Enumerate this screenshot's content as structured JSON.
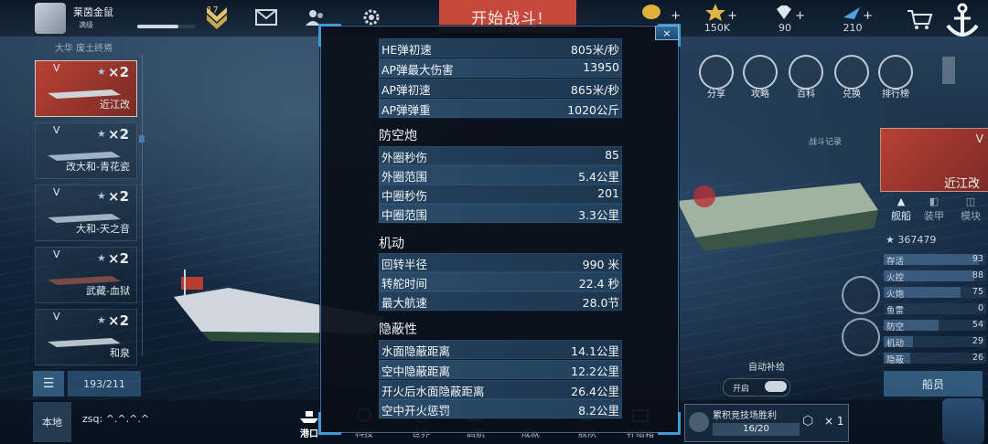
{
  "top": {
    "player_name": "莱茵金鼠",
    "player_sub": "满级",
    "level": "17",
    "start_battle": "开始战斗!",
    "resources": [
      {
        "name": "gold",
        "value": ""
      },
      {
        "name": "medal",
        "value": "150K"
      },
      {
        "name": "diamond",
        "value": "90"
      },
      {
        "name": "fighter",
        "value": "210"
      }
    ],
    "plus": "+"
  },
  "left": {
    "title": "大华 废土终焉",
    "ships": [
      {
        "tier": "V",
        "count": "×2",
        "name": "近江改"
      },
      {
        "tier": "V",
        "count": "×2",
        "name": "改大和-青花瓷"
      },
      {
        "tier": "V",
        "count": "×2",
        "name": "大和-天之音"
      },
      {
        "tier": "V",
        "count": "×2",
        "name": "武藏-血狱"
      },
      {
        "tier": "V",
        "count": "×2",
        "name": "和泉"
      }
    ],
    "count": "193/211"
  },
  "modal": {
    "close": "×",
    "top_rows": [
      {
        "k": "HE弹初速",
        "v": "805米/秒"
      },
      {
        "k": "AP弹最大伤害",
        "v": "13950"
      },
      {
        "k": "AP弹初速",
        "v": "865米/秒"
      },
      {
        "k": "AP弹弹重",
        "v": "1020公斤"
      }
    ],
    "sections": [
      {
        "title": "防空炮",
        "rows": [
          {
            "k": "外圈秒伤",
            "v": "85"
          },
          {
            "k": "外圈范围",
            "v": "5.4公里"
          },
          {
            "k": "中圈秒伤",
            "v": "201"
          },
          {
            "k": "中圈范围",
            "v": "3.3公里"
          }
        ]
      },
      {
        "title": "机动",
        "rows": [
          {
            "k": "回转半径",
            "v": "990 米"
          },
          {
            "k": "转舵时间",
            "v": "22.4 秒"
          },
          {
            "k": "最大航速",
            "v": "28.0节"
          }
        ]
      },
      {
        "title": "隐蔽性",
        "rows": [
          {
            "k": "水面隐蔽距离",
            "v": "14.1公里"
          },
          {
            "k": "空中隐蔽距离",
            "v": "12.2公里"
          },
          {
            "k": "开火后水面隐蔽距离",
            "v": "26.4公里"
          },
          {
            "k": "空中开火惩罚",
            "v": "8.2公里"
          }
        ]
      }
    ]
  },
  "right": {
    "menu": [
      {
        "label": "分享"
      },
      {
        "label": "攻略"
      },
      {
        "label": "百科"
      },
      {
        "label": "兑换"
      },
      {
        "label": "排行榜"
      }
    ],
    "battle_log": "战斗记录",
    "ship_tier": "V",
    "ship_name": "近江改",
    "tabs": [
      {
        "label": "舰船"
      },
      {
        "label": "装甲"
      },
      {
        "label": "模块"
      }
    ],
    "power": "367479",
    "stats": [
      {
        "k": "存活",
        "v": "93"
      },
      {
        "k": "火控",
        "v": "88"
      },
      {
        "k": "火炮",
        "v": "75"
      },
      {
        "k": "鱼雷",
        "v": "0"
      },
      {
        "k": "防空",
        "v": "54"
      },
      {
        "k": "机动",
        "v": "29"
      },
      {
        "k": "隐蔽",
        "v": "26"
      }
    ],
    "auto_supply": "自动补给",
    "auto_on": "开启",
    "crew": "船员"
  },
  "bottom": {
    "local": "本地",
    "chat": "zsq: ^.^.^.^",
    "nav": [
      {
        "label": "港口"
      },
      {
        "label": "科技"
      },
      {
        "label": "世界"
      },
      {
        "label": "启航"
      },
      {
        "label": "成就"
      },
      {
        "label": "舰队"
      },
      {
        "label": "补给箱"
      }
    ],
    "event_title": "累积竞技场胜利",
    "event_progress": "16/20",
    "event_count": "× 1"
  }
}
